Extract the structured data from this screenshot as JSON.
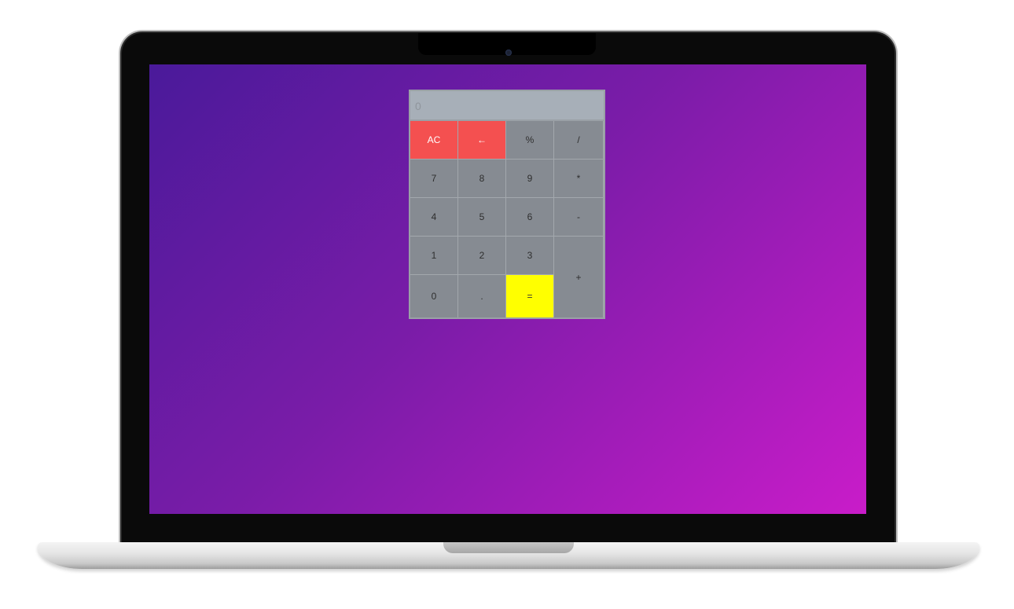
{
  "calculator": {
    "display_value": "0",
    "keys": {
      "ac": "AC",
      "backspace": "←",
      "percent": "%",
      "divide": "/",
      "seven": "7",
      "eight": "8",
      "nine": "9",
      "multiply": "*",
      "four": "4",
      "five": "5",
      "six": "6",
      "minus": "-",
      "one": "1",
      "two": "2",
      "three": "3",
      "plus": "+",
      "zero": "0",
      "dot": ".",
      "equals": "="
    }
  },
  "colors": {
    "background_start": "#4a1a9a",
    "background_end": "#c91cc9",
    "calculator_body": "#868b92",
    "display": "#a7afb8",
    "clear_keys": "#f45050",
    "equals_key": "#ffff00"
  }
}
